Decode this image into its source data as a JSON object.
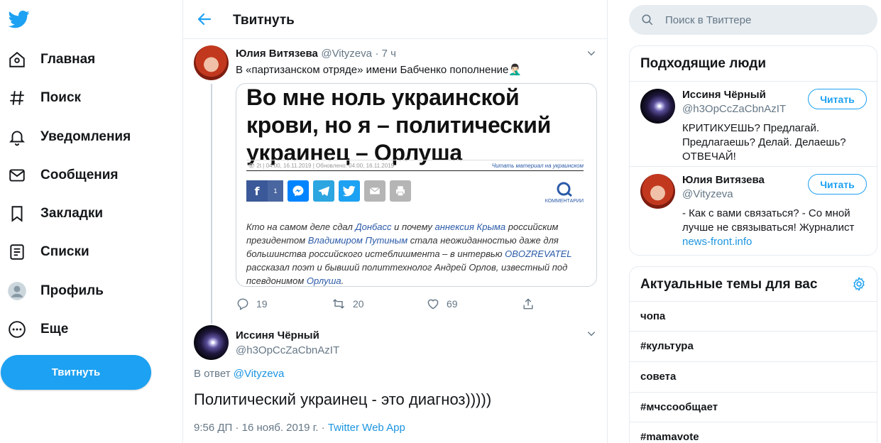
{
  "colors": {
    "accent": "#1da1f2",
    "link": "#1b95e0",
    "muted": "#657786",
    "border": "#e6ecf0"
  },
  "nav": {
    "items": [
      {
        "label": "Главная",
        "icon": "home-icon"
      },
      {
        "label": "Поиск",
        "icon": "hash-icon"
      },
      {
        "label": "Уведомления",
        "icon": "bell-icon"
      },
      {
        "label": "Сообщения",
        "icon": "envelope-icon"
      },
      {
        "label": "Закладки",
        "icon": "bookmark-icon"
      },
      {
        "label": "Списки",
        "icon": "list-icon"
      },
      {
        "label": "Профиль",
        "icon": "profile-icon"
      },
      {
        "label": "Еще",
        "icon": "more-icon"
      }
    ],
    "tweet_button": "Твитнуть"
  },
  "main": {
    "title": "Твитнуть",
    "tweet1": {
      "name": "Юлия Витязева",
      "handle": "@Vityzeva",
      "time": "· 7 ч",
      "text": "В «партизанском отряде» имени Бабченко пополнение🤦🏻‍♂️",
      "card": {
        "headline": "Во мне ноль украинской крови, но я – политический украинец – Орлуша",
        "meta_left": "👁 2t  |  04:00, 16.11.2019  |  Обновлено: 04:00, 16.11.2019",
        "meta_right": "Читать материал на украинском",
        "fb_count": "1",
        "comments_label": "КОММЕНТАРИИ",
        "body": {
          "p1": "Кто на самом деле сдал ",
          "l1": "Донбасс",
          "p2": " и почему ",
          "l2": "аннексия Крыма",
          "p3": " российским президентом ",
          "l3": "Владимиром Путиным",
          "p4": " стала неожиданностью даже для большинства российского истеблишмента – в интервью ",
          "l4": "OBOZREVATEL",
          "p5": " рассказал поэт и бывший политтехнолог Андрей Орлов, известный под псевдонимом ",
          "l5": "Орлуша",
          "p6": "."
        }
      },
      "replies": "19",
      "retweets": "20",
      "likes": "69"
    },
    "tweet2": {
      "name": "Иссиня Чёрный",
      "handle": "@h3OpCcZaCbnAzIT",
      "reply_prefix": "В ответ",
      "reply_handle": "@Vityzeva",
      "text": "Политический украинец - это диагноз)))))",
      "timestamp": "9:56 ДП · 16 нояб. 2019 г. · ",
      "source": "Twitter Web App"
    }
  },
  "right": {
    "search_placeholder": "Поиск в Твиттере",
    "who_to_follow": {
      "title": "Подходящие люди",
      "users": [
        {
          "name": "Иссиня Чёрный",
          "handle": "@h3OpCcZaCbnAzIT",
          "bio": "КРИТИКУЕШЬ? Предлагай. Предлагаешь? Делай. Делаешь? ОТВЕЧАЙ!",
          "bio_link": "",
          "follow": "Читать"
        },
        {
          "name": "Юлия Витязева",
          "handle": "@Vityzeva",
          "bio": "- Как с вами связаться? - Со мной лучше не связываться! Журналист ",
          "bio_link": "news-front.info",
          "follow": "Читать"
        }
      ]
    },
    "trends": {
      "title": "Актуальные темы для вас",
      "items": [
        "чопа",
        "#культура",
        "совета",
        "#мчссообщает",
        "#mamavote"
      ]
    }
  }
}
